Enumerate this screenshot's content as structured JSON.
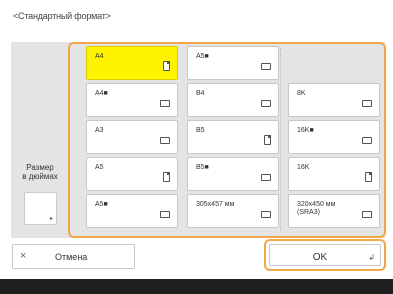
{
  "screen_title": "<Стандартный формат>",
  "inch_button": {
    "label": "Размер\nв дюймах"
  },
  "sizes": [
    {
      "label": "A4",
      "orientation": "portrait",
      "selected": true
    },
    {
      "label": "A5■",
      "orientation": "landscape",
      "selected": false
    },
    {
      "label": "A4■",
      "orientation": "landscape",
      "selected": false
    },
    {
      "label": "B4",
      "orientation": "landscape",
      "selected": false
    },
    {
      "label": "8K",
      "orientation": "landscape",
      "selected": false
    },
    {
      "label": "A3",
      "orientation": "landscape",
      "selected": false
    },
    {
      "label": "B5",
      "orientation": "portrait",
      "selected": false
    },
    {
      "label": "16K■",
      "orientation": "landscape",
      "selected": false
    },
    {
      "label": "A5",
      "orientation": "portrait",
      "selected": false
    },
    {
      "label": "B5■",
      "orientation": "landscape",
      "selected": false
    },
    {
      "label": "16K",
      "orientation": "portrait",
      "selected": false
    },
    {
      "label": "A5■",
      "orientation": "landscape",
      "selected": false
    },
    {
      "label": "305x457 мм",
      "orientation": "landscape",
      "selected": false
    },
    {
      "label": "320x450 мм\n(SRA3)",
      "orientation": "landscape",
      "selected": false
    }
  ],
  "cancel": {
    "icon": "close-icon",
    "symbol": "×",
    "label": "Отмена"
  },
  "ok": {
    "label": "OK",
    "icon": "enter-icon",
    "symbol": "↲"
  },
  "colors": {
    "accent": "#f2a64a",
    "selected": "#fff300",
    "panel": "#e2e4e6"
  }
}
